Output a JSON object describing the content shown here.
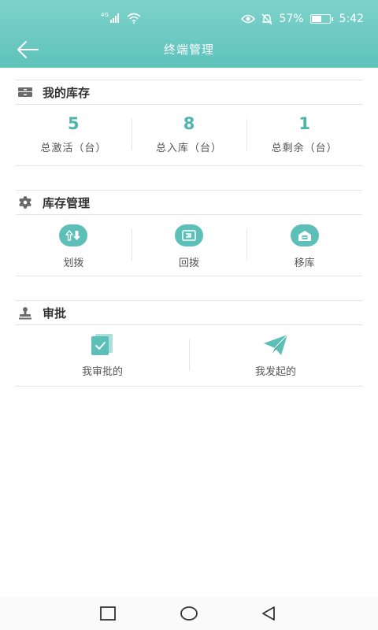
{
  "status_bar": {
    "network": "4G",
    "battery_text": "57%",
    "battery_level": 0.57,
    "time": "5:42"
  },
  "header": {
    "title": "终端管理"
  },
  "inventory": {
    "title": "我的库存",
    "stats": [
      {
        "value": "5",
        "label": "总激活（台）"
      },
      {
        "value": "8",
        "label": "总入库（台）"
      },
      {
        "value": "1",
        "label": "总剩余（台）"
      }
    ]
  },
  "management": {
    "title": "库存管理",
    "items": [
      {
        "label": "划拨",
        "icon": "transfer-icon"
      },
      {
        "label": "回拨",
        "icon": "return-icon"
      },
      {
        "label": "移库",
        "icon": "move-warehouse-icon"
      }
    ]
  },
  "approval": {
    "title": "审批",
    "items": [
      {
        "label": "我审批的",
        "icon": "approve-check-icon"
      },
      {
        "label": "我发起的",
        "icon": "paper-plane-icon"
      }
    ]
  },
  "colors": {
    "accent": "#5cc0b8",
    "header_top": "#7fd2cb",
    "stat_value": "#4eb5ac"
  }
}
